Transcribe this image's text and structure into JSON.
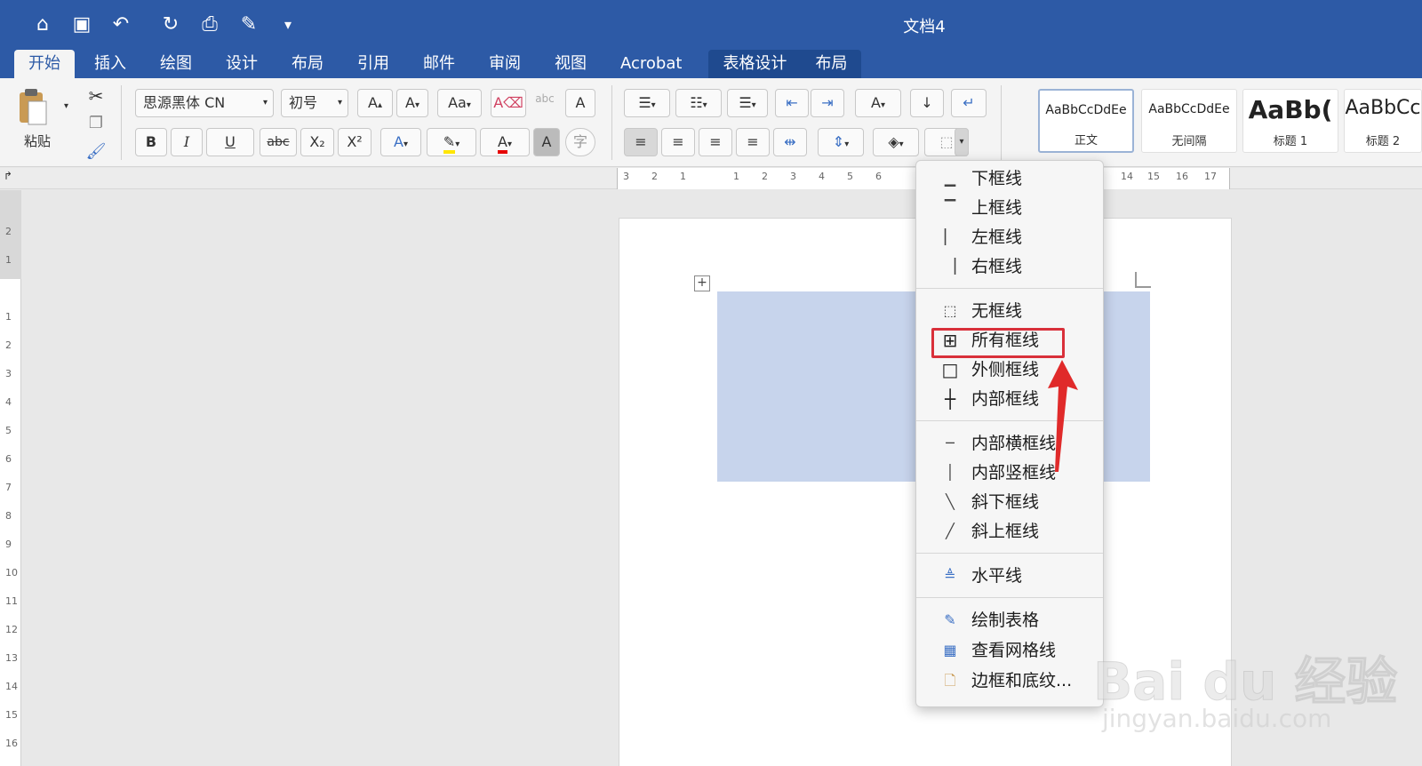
{
  "window": {
    "title": "文档4"
  },
  "quick_access": [
    {
      "icon": "home-icon",
      "glyph": "⌂"
    },
    {
      "icon": "save-icon",
      "glyph": "▣"
    },
    {
      "icon": "undo-icon",
      "glyph": "↶"
    },
    {
      "icon": "redo-icon",
      "glyph": "↻"
    },
    {
      "icon": "print-icon",
      "glyph": "⎙"
    },
    {
      "icon": "edit-icon",
      "glyph": "✎"
    },
    {
      "icon": "customize-icon",
      "glyph": "▾"
    }
  ],
  "tabs": [
    "开始",
    "插入",
    "绘图",
    "设计",
    "布局",
    "引用",
    "邮件",
    "审阅",
    "视图",
    "Acrobat"
  ],
  "context_tabs": [
    "表格设计",
    "布局"
  ],
  "ribbon": {
    "paste_label": "粘贴",
    "font_name": "思源黑体 CN",
    "font_size": "初号",
    "styles": [
      {
        "sample": "AaBbCcDdEe",
        "name": "正文"
      },
      {
        "sample": "AaBbCcDdEe",
        "name": "无间隔"
      },
      {
        "sample": "AaBb(",
        "name": "标题 1"
      },
      {
        "sample": "AaBbCc",
        "name": "标题 2"
      }
    ],
    "format_buttons": {
      "bold": "B",
      "italic": "I",
      "underline": "U",
      "strike": "abc",
      "subscript": "X₂",
      "superscript": "X²"
    }
  },
  "ruler": {
    "ticks": [
      "3",
      "2",
      "1",
      "1",
      "2",
      "3",
      "4",
      "5",
      "6",
      "14",
      "15",
      "16",
      "17"
    ]
  },
  "vruler": {
    "ticks": [
      "2",
      "1",
      "1",
      "2",
      "3",
      "4",
      "5",
      "6",
      "7",
      "8",
      "9",
      "10",
      "11",
      "12",
      "13",
      "14",
      "15",
      "16"
    ]
  },
  "menu": {
    "groups": [
      [
        "下框线",
        "上框线",
        "左框线",
        "右框线"
      ],
      [
        "无框线",
        "所有框线",
        "外侧框线",
        "内部框线"
      ],
      [
        "内部横框线",
        "内部竖框线",
        "斜下框线",
        "斜上框线"
      ],
      [
        "水平线"
      ],
      [
        "绘制表格",
        "查看网格线",
        "边框和底纹..."
      ]
    ],
    "highlighted": "所有框线",
    "highlight_color": "#d9303a"
  },
  "watermark": {
    "main": "Bai du 经验",
    "sub": "jingyan.baidu.com"
  }
}
